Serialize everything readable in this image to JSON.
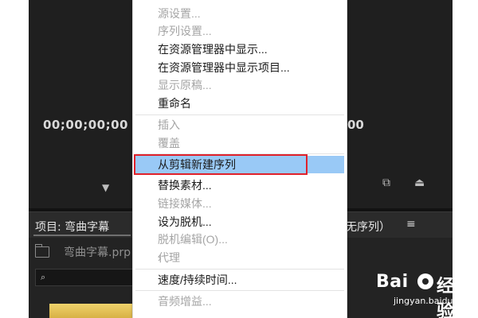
{
  "editor": {
    "timecode_left": "00;00;00;00",
    "timecode_right": "00",
    "project_panel_title": "项目: 弯曲字幕",
    "sequence_panel_title": "无序列）",
    "panel_menu_icon": "≡",
    "project_file_name": "弯曲字幕.prp",
    "search_icon_glyph": "⌕"
  },
  "context_menu": {
    "items": [
      {
        "label": "源设置...",
        "enabled": false
      },
      {
        "label": "序列设置...",
        "enabled": false
      },
      {
        "label": "在资源管理器中显示...",
        "enabled": true
      },
      {
        "label": "在资源管理器中显示项目...",
        "enabled": true
      },
      {
        "label": "显示原稿...",
        "enabled": false
      },
      {
        "label": "重命名",
        "enabled": true
      },
      {
        "label": "插入",
        "enabled": false
      },
      {
        "label": "覆盖",
        "enabled": false
      },
      {
        "label": "从剪辑新建序列",
        "enabled": true,
        "highlighted": true
      },
      {
        "label": "替换素材...",
        "enabled": true
      },
      {
        "label": "链接媒体...",
        "enabled": false
      },
      {
        "label": "设为脱机...",
        "enabled": true
      },
      {
        "label": "脱机编辑(O)...",
        "enabled": false
      },
      {
        "label": "代理",
        "enabled": false,
        "submenu": true
      },
      {
        "label": "速度/持续时间...",
        "enabled": true
      },
      {
        "label": "音频增益...",
        "enabled": false
      }
    ],
    "submenu_arrow": "›",
    "highlight_color": "#99c9f6"
  },
  "watermark": {
    "bai": "Bai",
    "jingyan": "经验",
    "url": "jingyan.baidu.com"
  },
  "colors": {
    "app_bg": "#232323",
    "annotation_red": "#e0212b"
  }
}
